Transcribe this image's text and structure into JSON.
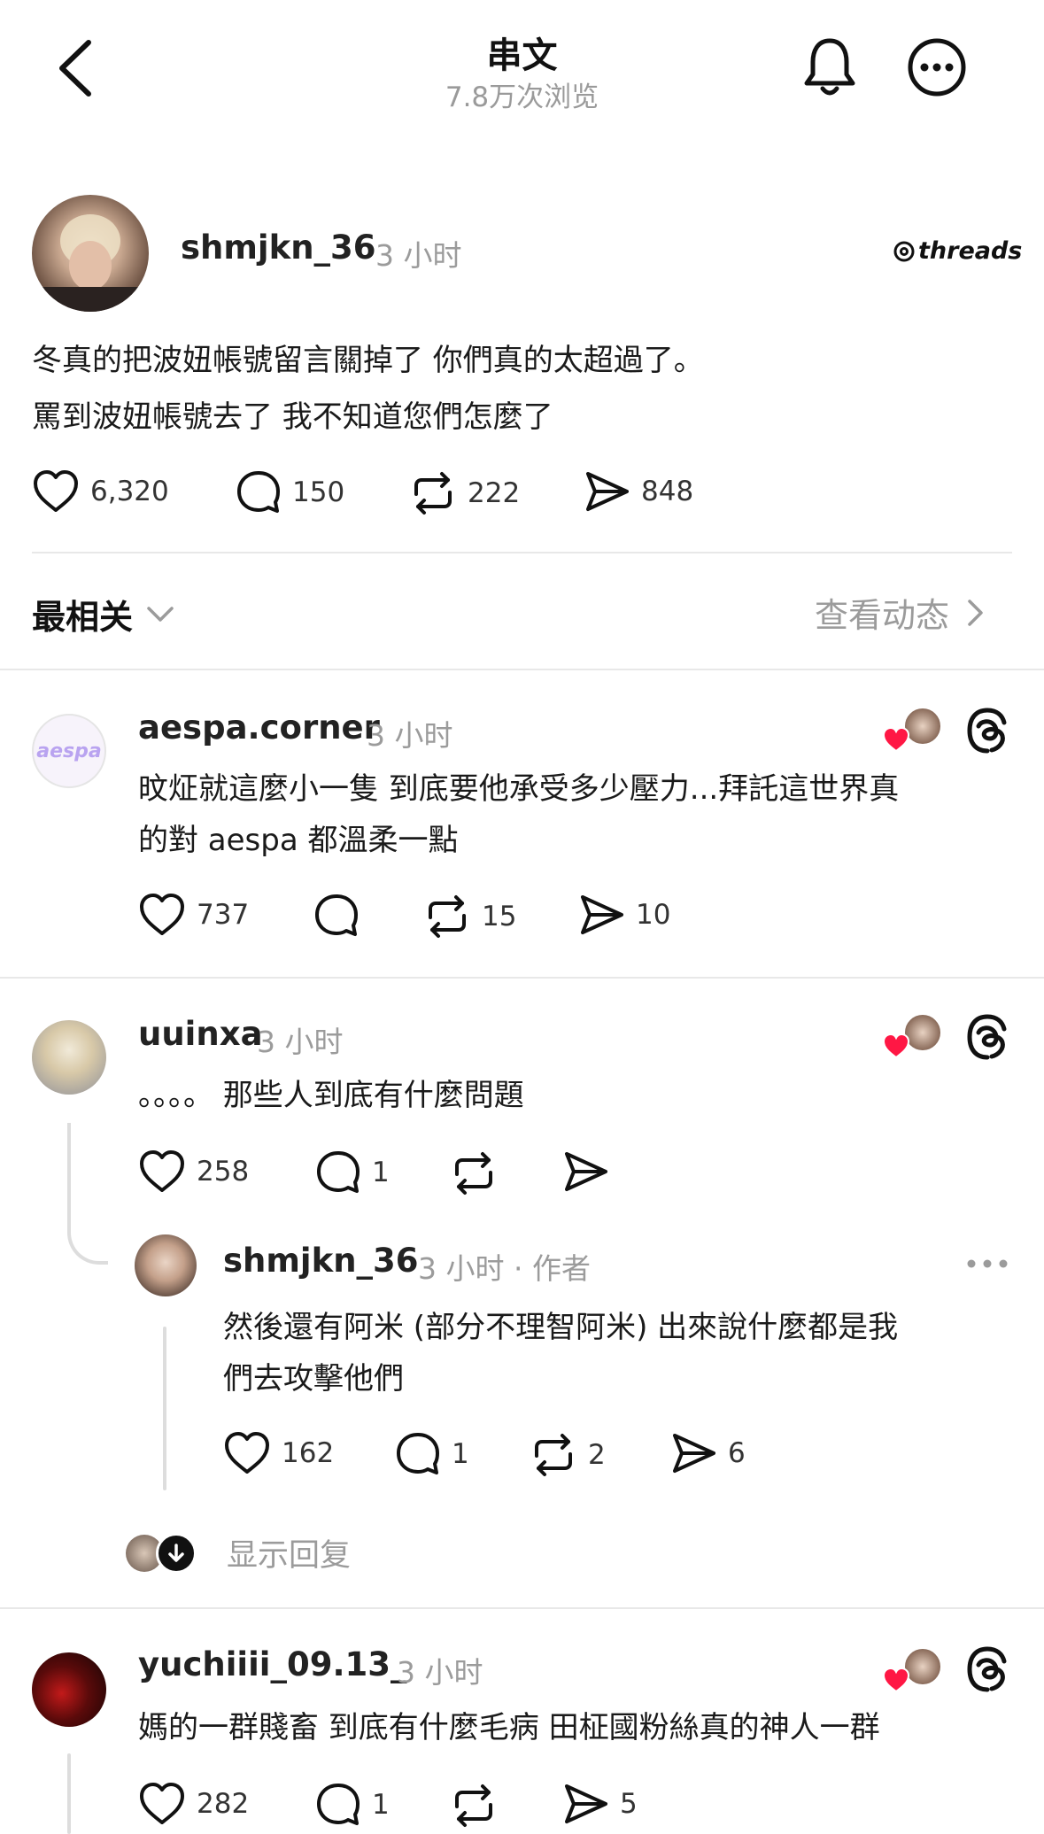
{
  "header": {
    "title": "串文",
    "views": "7.8万次浏览"
  },
  "post": {
    "username": "shmjkn_36",
    "time": "3 小时",
    "brand": "threads",
    "line1": "冬真的把波妞帳號留言關掉了 你們真的太超過了。",
    "line2": "罵到波妞帳號去了 我不知道您們怎麼了",
    "likes": "6,320",
    "replies": "150",
    "reposts": "222",
    "shares": "848"
  },
  "sort": {
    "label": "最相关",
    "activity": "查看动态"
  },
  "comments": [
    {
      "username": "aespa.corner",
      "time": "3 小时",
      "avatar_text": "aespa",
      "line1": "旼炡就這麼小一隻 到底要他承受多少壓力...拜託這世界真",
      "line2": "的對 aespa 都溫柔一點",
      "likes": "737",
      "replies": "",
      "reposts": "15",
      "shares": "10"
    },
    {
      "username": "uuinxa",
      "time": "3 小时",
      "line1": "。。。。 那些人到底有什麼問題",
      "likes": "258",
      "replies": "1",
      "reposts": "",
      "shares": ""
    },
    {
      "username": "shmjkn_36",
      "time": "3 小时 · 作者",
      "line1": "然後還有阿米 (部分不理智阿米) 出來說什麼都是我",
      "line2": "們去攻擊他們",
      "likes": "162",
      "replies": "1",
      "reposts": "2",
      "shares": "6"
    },
    {
      "username": "yuchiiii_09.13_",
      "time": "3 小时",
      "line1": "媽的一群賤畜 到底有什麼毛病 田柾國粉絲真的神人一群",
      "likes": "282",
      "replies": "1",
      "reposts": "",
      "shares": "5"
    }
  ],
  "show_replies": "显示回复",
  "colors": {
    "heart": "#ff1744",
    "muted": "#9b9b9b",
    "divider": "#e8e8e8"
  }
}
